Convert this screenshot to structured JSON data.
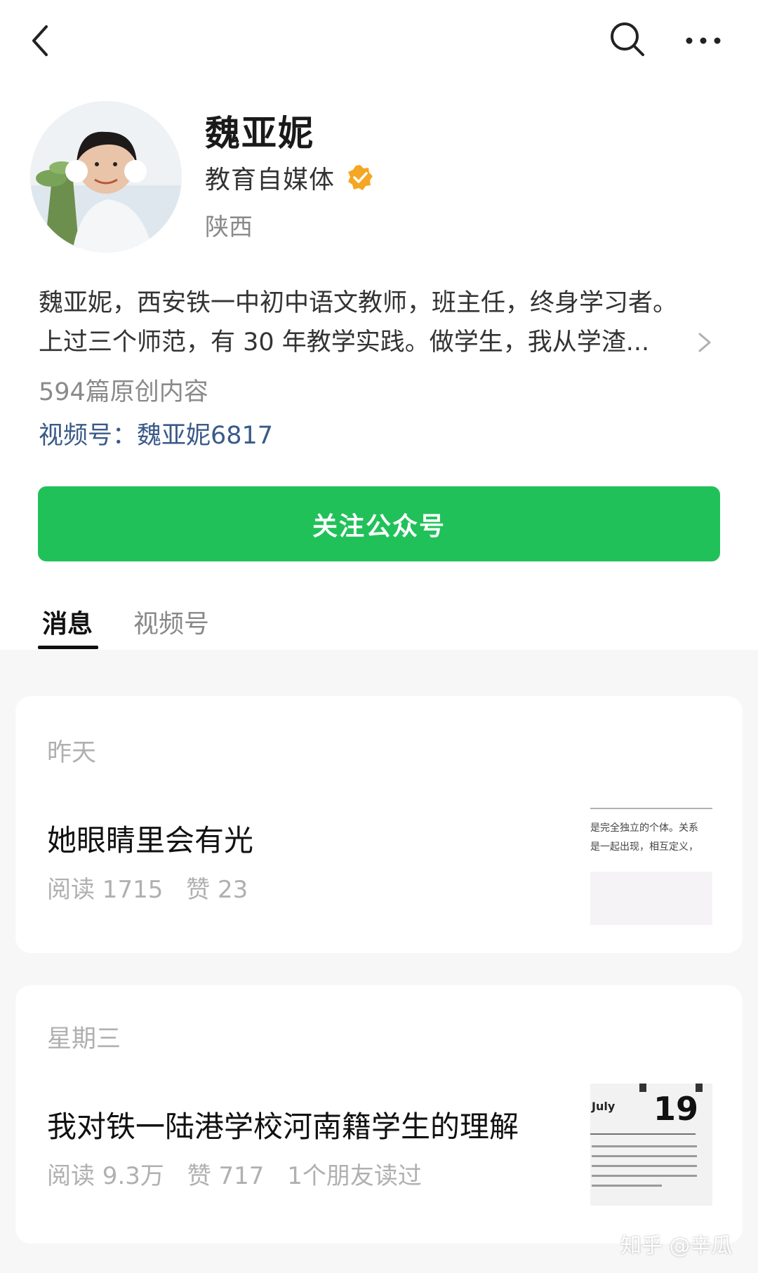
{
  "account": {
    "name": "魏亚妮",
    "category": "教育自媒体",
    "region": "陕西",
    "bio_line1": "魏亚妮，西安铁一中初中语文教师，班主任，终身学习者。",
    "bio_line2": "上过三个师范，有 30 年教学实践。做学生，我从学渣...",
    "originals": "594篇原创内容",
    "channel": "视频号：魏亚妮6817"
  },
  "follow_button": "关注公众号",
  "tabs": [
    "消息",
    "视频号"
  ],
  "articles": [
    {
      "date": "昨天",
      "title": "她眼睛里会有光",
      "reads": "阅读 1715",
      "likes": "赞 23",
      "friends": "",
      "thumb_text1": "是完全独立的个体。关系",
      "thumb_text2": "是一起出现，相互定义，"
    },
    {
      "date": "星期三",
      "title": "我对铁一陆港学校河南籍学生的理解",
      "reads": "阅读 9.3万",
      "likes": "赞 717",
      "friends": "1个朋友读过",
      "thumb_month": "July",
      "thumb_day": "19"
    }
  ],
  "watermark": "知乎 @辛瓜",
  "colors": {
    "brand_green": "#21c15a",
    "link_blue": "#3a5a88",
    "verified_orange": "#f5a623"
  }
}
